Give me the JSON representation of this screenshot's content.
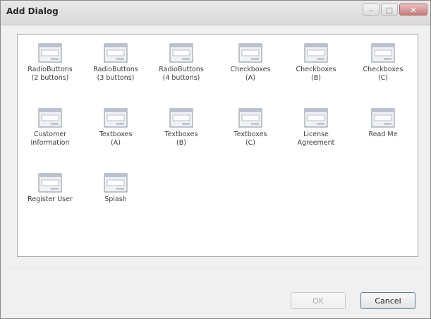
{
  "window": {
    "title": "Add Dialog",
    "controls": {
      "minimize": "–",
      "maximize": "□",
      "close": "✕"
    }
  },
  "dialogs": [
    {
      "label": "RadioButtons\n(2 buttons)"
    },
    {
      "label": "RadioButtons\n(3 buttons)"
    },
    {
      "label": "RadioButtons\n(4 buttons)"
    },
    {
      "label": "Checkboxes\n(A)"
    },
    {
      "label": "Checkboxes\n(B)"
    },
    {
      "label": "Checkboxes\n(C)"
    },
    {
      "label": "Customer\nInformation"
    },
    {
      "label": "Textboxes\n(A)"
    },
    {
      "label": "Textboxes\n(B)"
    },
    {
      "label": "Textboxes\n(C)"
    },
    {
      "label": "License\nAgreement"
    },
    {
      "label": "Read Me"
    },
    {
      "label": "Register User"
    },
    {
      "label": "Splash"
    }
  ],
  "buttons": {
    "ok": "OK",
    "cancel": "Cancel"
  },
  "icon": "dialog-window-icon"
}
